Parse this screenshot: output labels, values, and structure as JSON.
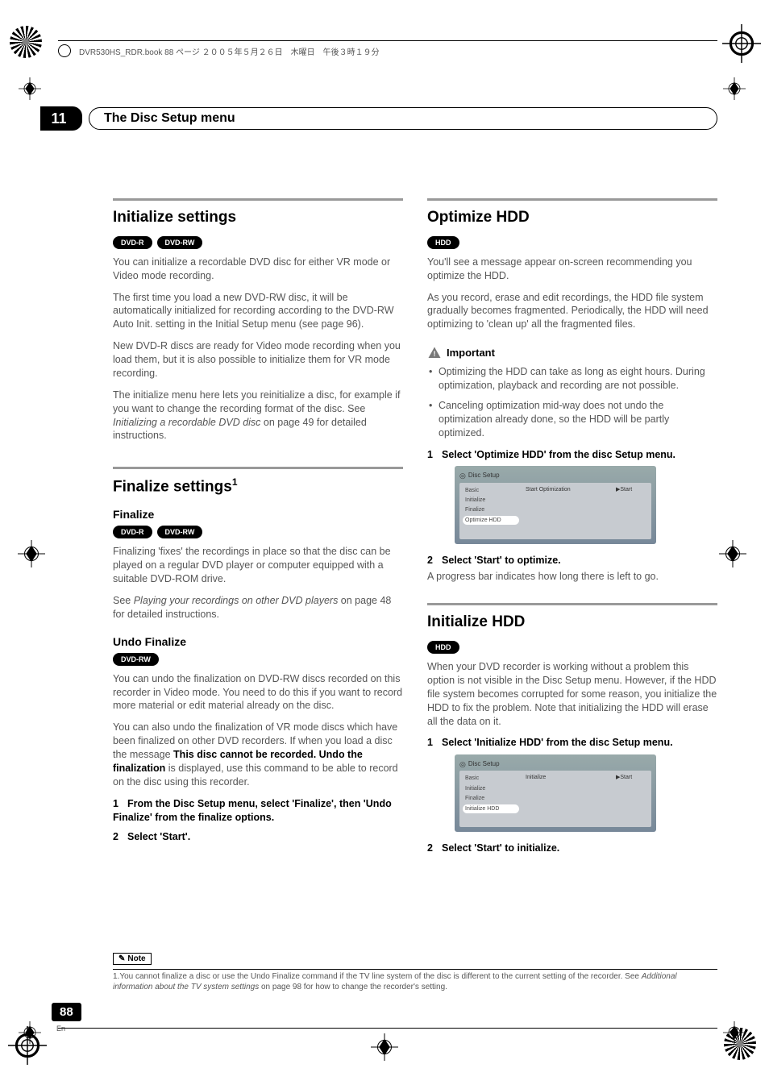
{
  "header_text": "DVR530HS_RDR.book  88 ページ  ２００５年５月２６日　木曜日　午後３時１９分",
  "chapter": {
    "number": "11",
    "title": "The Disc Setup menu"
  },
  "left": {
    "sec1": {
      "title": "Initialize settings",
      "badges": [
        "DVD-R",
        "DVD-RW"
      ],
      "p1": "You can initialize a recordable DVD disc for either VR mode or Video mode recording.",
      "p2": "The first time you load a new DVD-RW disc, it will be automatically initialized for recording according to the DVD-RW Auto Init. setting in the Initial Setup menu (see page 96).",
      "p3": "New DVD-R discs are ready for Video mode recording when you load them, but it is also possible to initialize them for VR mode recording.",
      "p4a": "The initialize menu here lets you reinitialize a disc, for example if you want to change the recording format of the disc. See ",
      "p4i": "Initializing a recordable DVD disc",
      "p4b": " on page 49 for detailed instructions."
    },
    "sec2": {
      "title": "Finalize settings",
      "sup": "1",
      "sub1": {
        "heading": "Finalize",
        "badges": [
          "DVD-R",
          "DVD-RW"
        ],
        "p1": "Finalizing 'fixes' the recordings in place so that the disc can be played on a regular DVD player or computer equipped with a suitable DVD-ROM drive.",
        "p2a": "See ",
        "p2i": "Playing your recordings on other DVD players",
        "p2b": " on page 48 for detailed instructions."
      },
      "sub2": {
        "heading": "Undo Finalize",
        "badges": [
          "DVD-RW"
        ],
        "p1": "You can undo the finalization on DVD-RW discs recorded on this recorder in Video mode. You need to do this if you want to record more material or edit material already on the disc.",
        "p2a": "You can also undo the finalization of VR mode discs which have been finalized on other DVD recorders. If when you load a disc the message ",
        "p2b1": "This disc cannot be recorded. Undo the finalization",
        "p2c": " is displayed, use this command to be able to record on the disc using this recorder.",
        "step1": "From the Disc Setup menu, select 'Finalize', then 'Undo Finalize' from the finalize options.",
        "step2": "Select 'Start'."
      }
    }
  },
  "right": {
    "sec1": {
      "title": "Optimize HDD",
      "badges": [
        "HDD"
      ],
      "p1": "You'll see a message appear on-screen recommending you optimize the HDD.",
      "p2": "As you record, erase and edit recordings, the HDD file system gradually becomes fragmented. Periodically, the HDD will need optimizing to 'clean up' all the fragmented files.",
      "important_label": "Important",
      "bullets": [
        "Optimizing the HDD can take as long as eight hours. During optimization, playback and recording are not possible.",
        "Canceling optimization mid-way does not undo the optimization already done, so the HDD will be partly optimized."
      ],
      "step1": "Select 'Optimize HDD' from the disc Setup menu.",
      "ui": {
        "title": "Disc Setup",
        "side": [
          "Basic",
          "Initialize",
          "Finalize",
          "Optimize HDD"
        ],
        "mid": "Start Optimization",
        "right": "▶Start"
      },
      "step2": "Select 'Start' to optimize.",
      "step2_body": "A progress bar indicates how long there is left to go."
    },
    "sec2": {
      "title": "Initialize HDD",
      "badges": [
        "HDD"
      ],
      "p1": "When your DVD recorder is working without a problem this option is not visible in the Disc Setup menu. However, if the HDD file system becomes corrupted for some reason, you initialize the HDD to fix the problem. Note that initializing the HDD will erase all the data on it.",
      "step1": "Select 'Initialize HDD' from the disc Setup menu.",
      "ui": {
        "title": "Disc Setup",
        "side": [
          "Basic",
          "Initialize",
          "Finalize",
          "Initialize HDD"
        ],
        "mid": "Initialize",
        "right": "▶Start"
      },
      "step2": "Select 'Start' to initialize."
    }
  },
  "note": {
    "label": "Note",
    "line1a": "1.You cannot finalize a disc or use the Undo Finalize command if the TV line system of the disc is different to the current setting of the recorder. See ",
    "line1i": "Additional information about the TV system settings",
    "line1b": " on page 98 for how to change the recorder's setting."
  },
  "page": {
    "number": "88",
    "lang": "En"
  }
}
